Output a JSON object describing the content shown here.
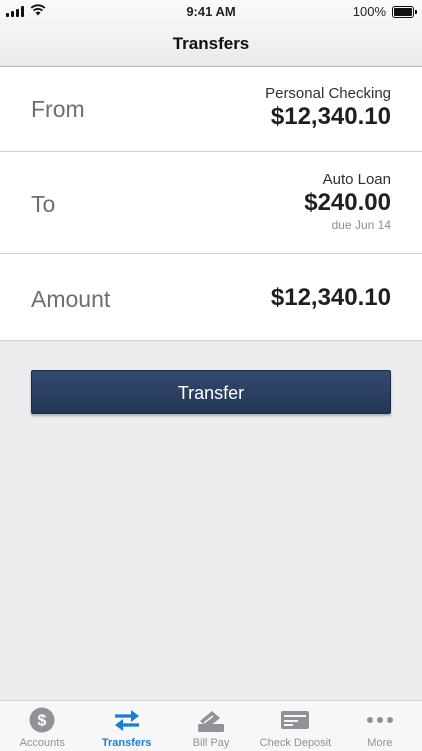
{
  "status_bar": {
    "time": "9:41 AM",
    "battery": "100%"
  },
  "header": {
    "title": "Transfers"
  },
  "transfer_form": {
    "from": {
      "label": "From",
      "account_name": "Personal Checking",
      "balance": "$12,340.10"
    },
    "to": {
      "label": "To",
      "account_name": "Auto Loan",
      "amount_due": "$240.00",
      "due_date": "due Jun 14"
    },
    "amount": {
      "label": "Amount",
      "value": "$12,340.10"
    },
    "submit_label": "Transfer"
  },
  "tab_bar": {
    "items": [
      {
        "label": "Accounts",
        "icon": "dollar-circle-icon"
      },
      {
        "label": "Transfers",
        "icon": "transfer-arrows-icon",
        "active": true
      },
      {
        "label": "Bill Pay",
        "icon": "bill-pay-icon"
      },
      {
        "label": "Check Deposit",
        "icon": "check-icon"
      },
      {
        "label": "More",
        "icon": "more-dots-icon"
      }
    ]
  },
  "colors": {
    "accent": "#1a7ed6",
    "button": "#2b3f60",
    "background": "#ebecee"
  }
}
